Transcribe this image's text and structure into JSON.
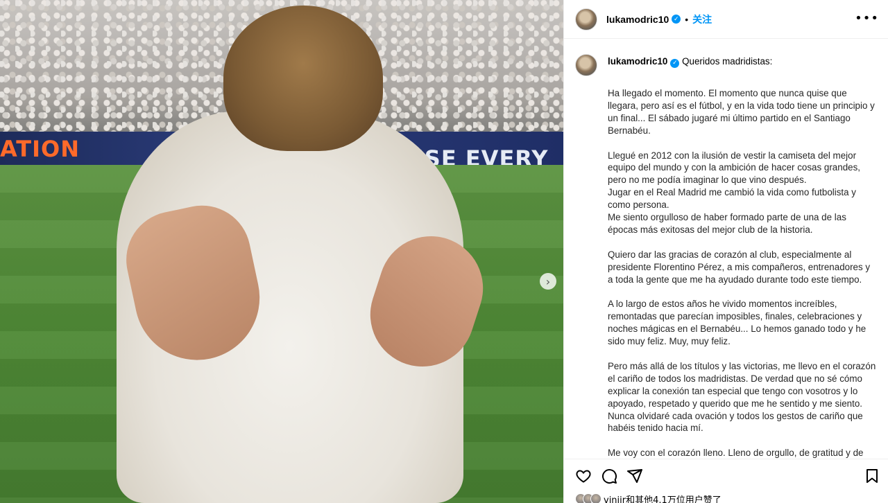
{
  "photo": {
    "ad_left": "ATION",
    "ad_right": "AUSE EVERY CH",
    "next_icon": "chevron-right-icon"
  },
  "header": {
    "username": "lukamodric10",
    "verified_icon": "verified-badge-icon",
    "separator": "•",
    "follow_label": "关注",
    "more_label": "•••"
  },
  "caption": {
    "username": "lukamodric10",
    "first_line": "Queridos madridistas:",
    "body": "Ha llegado el momento. El momento que nunca quise que llegara, pero así es el fútbol, y en la vida todo tiene un principio y un final... El sábado jugaré mi último partido en el Santiago Bernabéu.\n\nLlegué en 2012 con la ilusión de vestir la camiseta del mejor equipo del mundo y con la ambición de hacer cosas grandes, pero no me podía imaginar lo que vino después.\nJugar en el Real Madrid me cambió la vida como futbolista y como persona.\nMe siento orgulloso de haber formado parte de una de las épocas más exitosas del mejor club de la historia.\n\nQuiero dar las gracias de corazón al club, especialmente al presidente Florentino Pérez, a mis compañeros, entrenadores y a toda la gente que me ha ayudado durante todo este tiempo.\n\nA lo largo de estos años he vivido momentos increíbles, remontadas que parecían imposibles, finales, celebraciones y noches mágicas en el Bernabéu... Lo hemos ganado todo y he sido muy feliz. Muy, muy feliz.\n\nPero más allá de los títulos y las victorias, me llevo en el corazón el cariño de todos los madridistas. De verdad que no sé cómo explicar la conexión tan especial que tengo con vosotros y lo apoyado, respetado y querido que me he sentido y me siento. Nunca olvidaré cada ovación y todos los gestos de cariño que habéis tenido hacia mí.\n\nMe voy con el corazón lleno. Lleno de orgullo, de gratitud y de recuerdos imborrables. Y aunque, tras el Mundial de Clubes, ya no vaya a vestir más esta camiseta sobre el césped, yo siempre seré"
  },
  "actions": {
    "like_icon": "heart-icon",
    "comment_icon": "comment-icon",
    "share_icon": "send-icon",
    "save_icon": "bookmark-icon"
  },
  "likes": {
    "text": "vinjjr和其他4.1万位用户赞了"
  }
}
